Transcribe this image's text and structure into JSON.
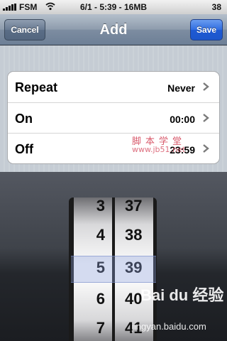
{
  "status_bar": {
    "carrier": "FSM",
    "center_text": "6/1 - 5:39 - 16MB",
    "battery": "38"
  },
  "nav": {
    "title": "Add",
    "cancel_label": "Cancel",
    "save_label": "Save"
  },
  "rows": [
    {
      "label": "Repeat",
      "value": "Never"
    },
    {
      "label": "On",
      "value": "00:00"
    },
    {
      "label": "Off",
      "value": "23:59"
    }
  ],
  "picker": {
    "hours": [
      "3",
      "4",
      "5",
      "6",
      "7"
    ],
    "minutes": [
      "37",
      "38",
      "39",
      "40",
      "41"
    ],
    "selected_hour": "5",
    "selected_minute": "39"
  },
  "watermarks": {
    "jb51_chars": "脚本学堂",
    "jb51_url": "www.jb51.net",
    "baidu": "Bai du 经验",
    "baidu_url": "jingyan.baidu.com"
  },
  "colors": {
    "save_button": "#2f6ce0",
    "nav_bar": "#8e9cad"
  },
  "icons": [
    "signal-icon",
    "wifi-icon",
    "chevron-right-icon"
  ]
}
